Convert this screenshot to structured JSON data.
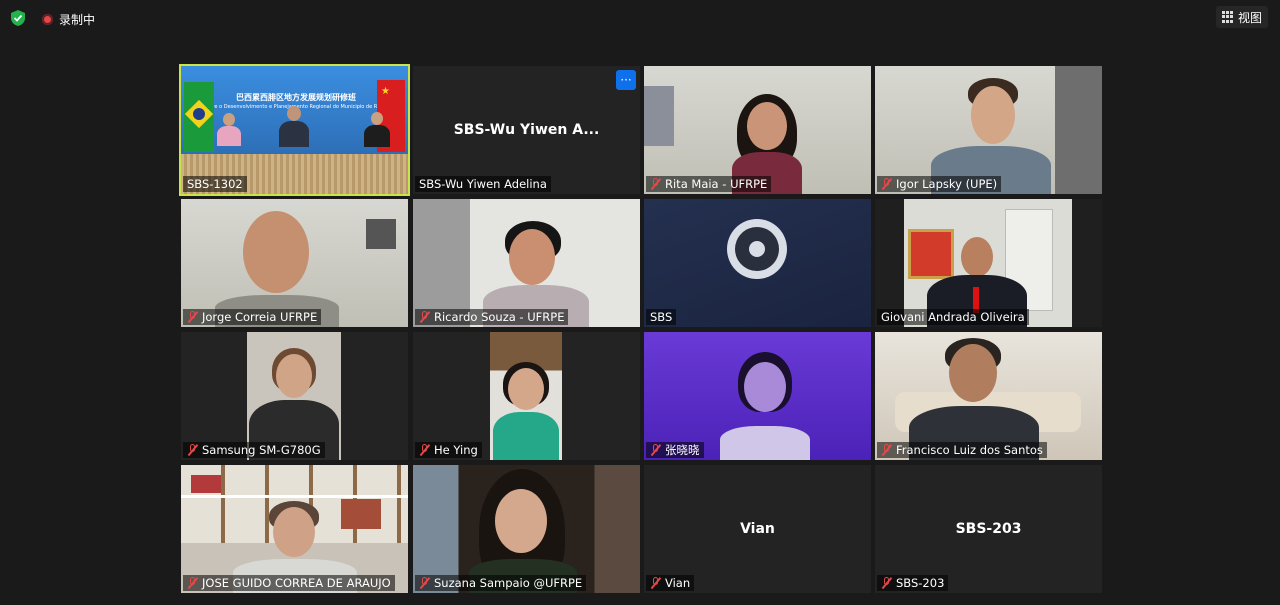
{
  "topbar": {
    "recording_label": "录制中",
    "view_label": "视图"
  },
  "conference": {
    "banner_title": "巴西累西腓区地方发展规划研修班",
    "banner_subtitle": "o sobre o Desenvolvimento e Planejamento Regional do Municipio de Recife (Brasil)"
  },
  "participants": [
    {
      "name": "SBS-1302",
      "muted": false,
      "video": true,
      "active_speaker": true
    },
    {
      "name": "SBS-Wu Yiwen Adelina",
      "center_label": "SBS-Wu  Yiwen  A...",
      "muted": false,
      "video": false
    },
    {
      "name": "Rita Maia - UFRPE",
      "muted": true,
      "video": true
    },
    {
      "name": "Igor Lapsky (UPE)",
      "muted": true,
      "video": true
    },
    {
      "name": "Jorge Correia UFRPE",
      "muted": true,
      "video": true
    },
    {
      "name": "Ricardo Souza - UFRPE",
      "muted": true,
      "video": true
    },
    {
      "name": "SBS",
      "muted": false,
      "video": true
    },
    {
      "name": "Giovani Andrada Oliveira",
      "muted": false,
      "video": true
    },
    {
      "name": "Samsung SM-G780G",
      "muted": true,
      "video": true
    },
    {
      "name": "He Ying",
      "muted": true,
      "video": true
    },
    {
      "name": "张晓晓",
      "muted": true,
      "video": true
    },
    {
      "name": "Francisco Luiz dos Santos",
      "muted": true,
      "video": true
    },
    {
      "name": "JOSE GUIDO CORREA DE ARAUJO",
      "muted": true,
      "video": true
    },
    {
      "name": "Suzana Sampaio @UFRPE",
      "muted": true,
      "video": true
    },
    {
      "name": "Vian",
      "center_label": "Vian",
      "muted": true,
      "video": false
    },
    {
      "name": "SBS-203",
      "center_label": "SBS-203",
      "muted": true,
      "video": false
    }
  ],
  "icons": {
    "security": "shield-check-icon",
    "recording": "record-dot-icon",
    "view": "grid-view-icon",
    "muted": "mic-muted-icon",
    "more": "more-options-icon"
  },
  "colors": {
    "active_speaker_border": "#c8e44a",
    "muted_icon": "#e54848",
    "more_button": "#0e71eb",
    "background": "#1a1a1a"
  }
}
